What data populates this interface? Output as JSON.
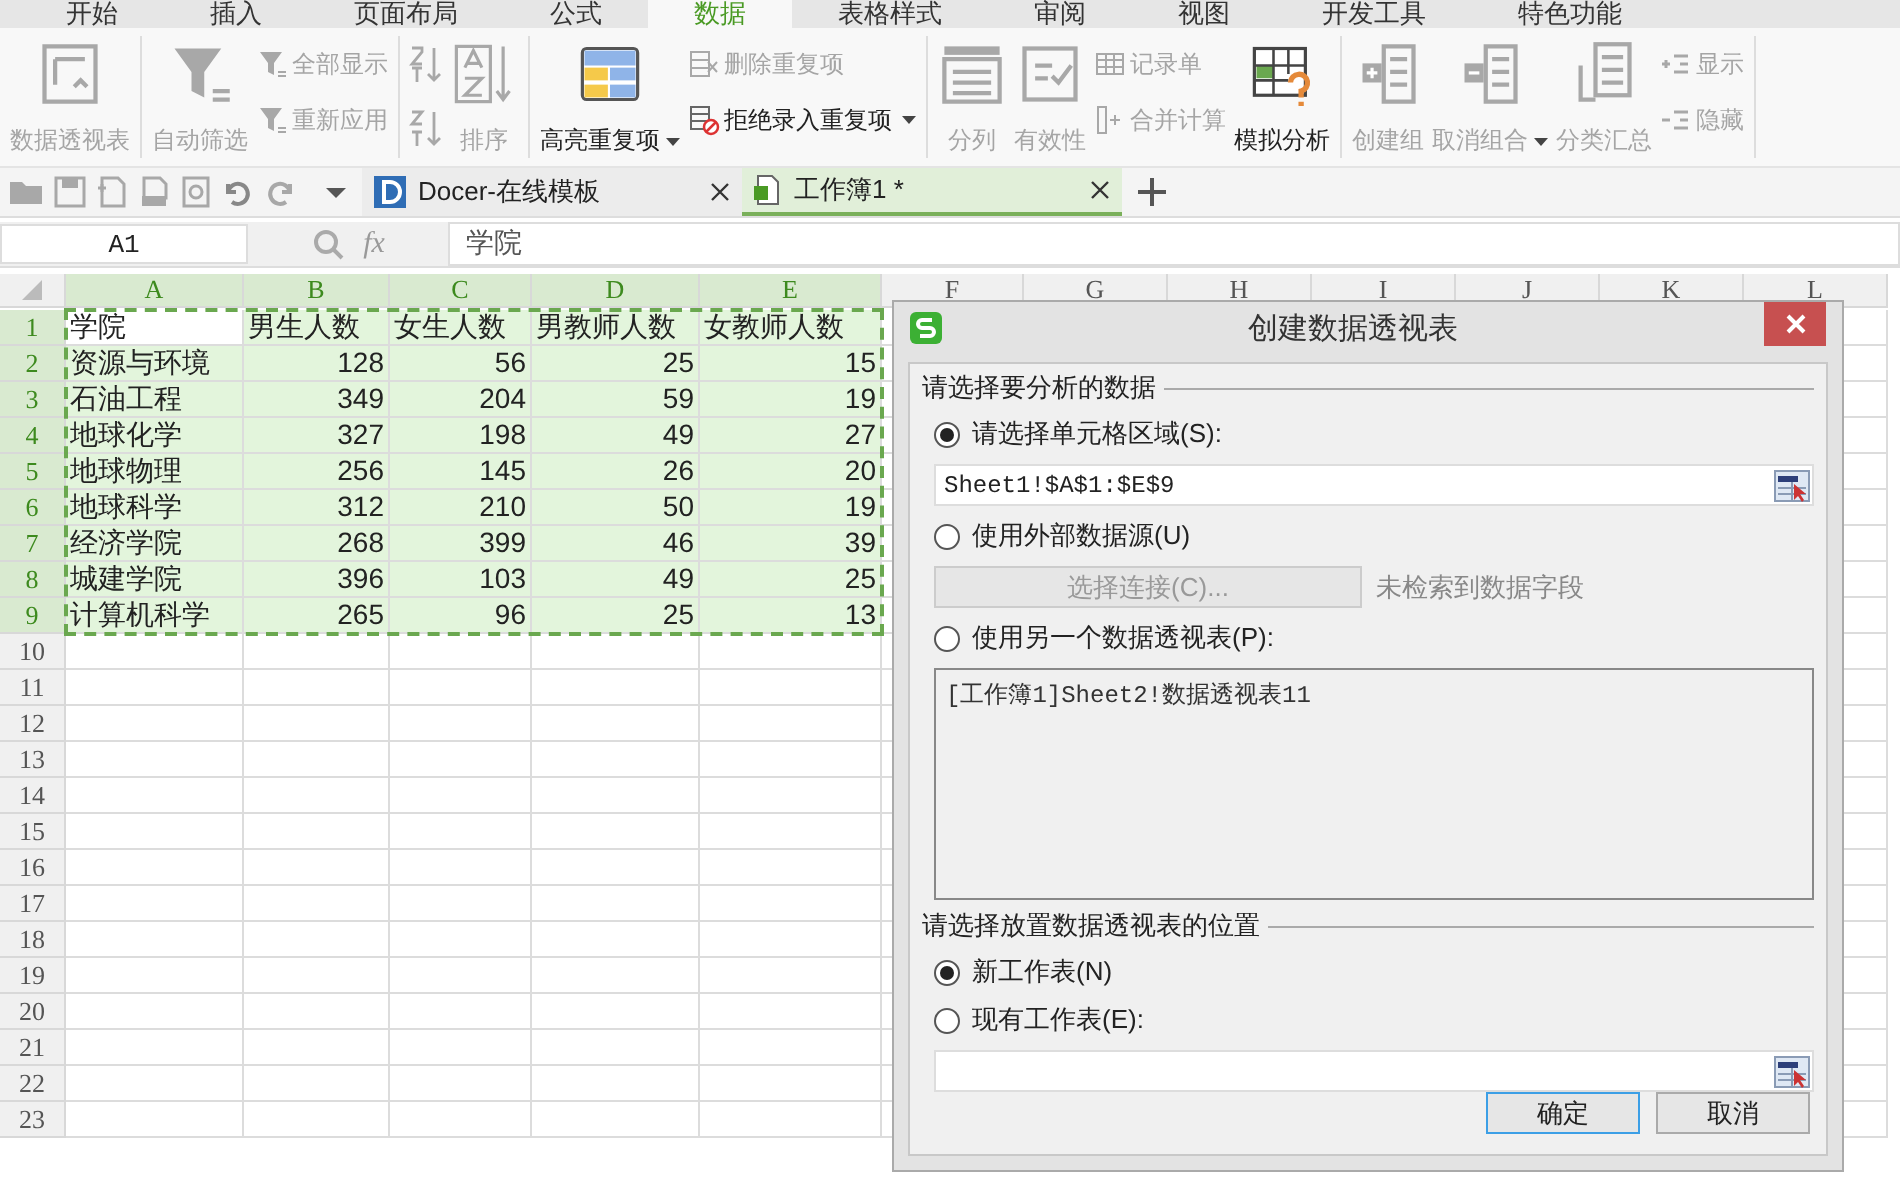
{
  "menu_tabs": [
    {
      "label": "开始",
      "selected": false
    },
    {
      "label": "插入",
      "selected": false
    },
    {
      "label": "页面布局",
      "selected": false
    },
    {
      "label": "公式",
      "selected": false
    },
    {
      "label": "数据",
      "selected": true
    },
    {
      "label": "表格样式",
      "selected": false
    },
    {
      "label": "审阅",
      "selected": false
    },
    {
      "label": "视图",
      "selected": false
    },
    {
      "label": "开发工具",
      "selected": false
    },
    {
      "label": "特色功能",
      "selected": false
    }
  ],
  "ribbon": {
    "groups": [
      {
        "items": [
          {
            "label": "数据透视表",
            "kind": "large",
            "disabled": true,
            "dropdown": false
          }
        ]
      },
      {
        "items": [
          {
            "label": "自动筛选",
            "kind": "large",
            "disabled": true,
            "dropdown": false
          },
          {
            "label": "全部显示",
            "kind": "small",
            "disabled": true,
            "dropdown": false
          },
          {
            "label": "重新应用",
            "kind": "small",
            "disabled": true,
            "dropdown": false
          }
        ]
      },
      {
        "items": [
          {
            "label": "排序",
            "kind": "sort",
            "disabled": true,
            "dropdown": false
          }
        ]
      },
      {
        "items": [
          {
            "label": "高亮重复项",
            "kind": "large",
            "disabled": false,
            "dropdown": true
          },
          {
            "label": "删除重复项",
            "kind": "small",
            "disabled": true,
            "dropdown": false
          },
          {
            "label": "拒绝录入重复项",
            "kind": "small",
            "disabled": false,
            "dropdown": true
          }
        ]
      },
      {
        "items": [
          {
            "label": "分列",
            "kind": "large",
            "disabled": true,
            "dropdown": false
          },
          {
            "label": "有效性",
            "kind": "large",
            "disabled": true,
            "dropdown": false
          },
          {
            "label": "记录单",
            "kind": "small",
            "disabled": true,
            "dropdown": false
          },
          {
            "label": "合并计算",
            "kind": "small",
            "disabled": true,
            "dropdown": false
          },
          {
            "label": "模拟分析",
            "kind": "large",
            "disabled": false,
            "dropdown": false
          }
        ]
      },
      {
        "items": [
          {
            "label": "创建组",
            "kind": "large",
            "disabled": true,
            "dropdown": false
          },
          {
            "label": "取消组合",
            "kind": "large",
            "disabled": true,
            "dropdown": true
          },
          {
            "label": "分类汇总",
            "kind": "large",
            "disabled": true,
            "dropdown": false
          },
          {
            "label": "显示",
            "kind": "small",
            "disabled": true,
            "dropdown": false
          },
          {
            "label": "隐藏",
            "kind": "small",
            "disabled": true,
            "dropdown": false
          }
        ]
      }
    ]
  },
  "doc_tabs": [
    {
      "label": "Docer-在线模板",
      "selected": false
    },
    {
      "label": "工作簿1 *",
      "selected": true
    }
  ],
  "formula_bar": {
    "name_box": "A1",
    "fx_label": "fx",
    "content": "学院"
  },
  "sheet": {
    "columns": [
      {
        "label": "A",
        "selected": true
      },
      {
        "label": "B",
        "selected": true
      },
      {
        "label": "C",
        "selected": true
      },
      {
        "label": "D",
        "selected": true
      },
      {
        "label": "E",
        "selected": true
      },
      {
        "label": "F",
        "selected": false
      },
      {
        "label": "G",
        "selected": false
      },
      {
        "label": "H",
        "selected": false
      },
      {
        "label": "I",
        "selected": false
      },
      {
        "label": "J",
        "selected": false
      },
      {
        "label": "K",
        "selected": false
      },
      {
        "label": "L",
        "selected": false
      }
    ],
    "rows": [
      {
        "label": "1",
        "selected": true,
        "active": true,
        "kind": "header",
        "cells": [
          "学院",
          "男生人数",
          "女生人数",
          "男教师人数",
          "女教师人数"
        ]
      },
      {
        "label": "2",
        "selected": true,
        "active": false,
        "kind": "data",
        "cells": [
          "资源与环境",
          "128",
          "56",
          "25",
          "15"
        ]
      },
      {
        "label": "3",
        "selected": true,
        "active": false,
        "kind": "data",
        "cells": [
          "石油工程",
          "349",
          "204",
          "59",
          "19"
        ]
      },
      {
        "label": "4",
        "selected": true,
        "active": false,
        "kind": "data",
        "cells": [
          "地球化学",
          "327",
          "198",
          "49",
          "27"
        ]
      },
      {
        "label": "5",
        "selected": true,
        "active": false,
        "kind": "data",
        "cells": [
          "地球物理",
          "256",
          "145",
          "26",
          "20"
        ]
      },
      {
        "label": "6",
        "selected": true,
        "active": false,
        "kind": "data",
        "cells": [
          "地球科学",
          "312",
          "210",
          "50",
          "19"
        ]
      },
      {
        "label": "7",
        "selected": true,
        "active": false,
        "kind": "data",
        "cells": [
          "经济学院",
          "268",
          "399",
          "46",
          "39"
        ]
      },
      {
        "label": "8",
        "selected": true,
        "active": false,
        "kind": "data",
        "cells": [
          "城建学院",
          "396",
          "103",
          "49",
          "25"
        ]
      },
      {
        "label": "9",
        "selected": true,
        "active": false,
        "kind": "data",
        "cells": [
          "计算机科学",
          "265",
          "96",
          "25",
          "13"
        ]
      },
      {
        "label": "10",
        "selected": false,
        "active": false,
        "kind": "data",
        "cells": []
      },
      {
        "label": "11",
        "selected": false,
        "active": false,
        "kind": "data",
        "cells": []
      },
      {
        "label": "12",
        "selected": false,
        "active": false,
        "kind": "data",
        "cells": []
      },
      {
        "label": "13",
        "selected": false,
        "active": false,
        "kind": "data",
        "cells": []
      },
      {
        "label": "14",
        "selected": false,
        "active": false,
        "kind": "data",
        "cells": []
      },
      {
        "label": "15",
        "selected": false,
        "active": false,
        "kind": "data",
        "cells": []
      },
      {
        "label": "16",
        "selected": false,
        "active": false,
        "kind": "data",
        "cells": []
      },
      {
        "label": "17",
        "selected": false,
        "active": false,
        "kind": "data",
        "cells": []
      },
      {
        "label": "18",
        "selected": false,
        "active": false,
        "kind": "data",
        "cells": []
      },
      {
        "label": "19",
        "selected": false,
        "active": false,
        "kind": "data",
        "cells": []
      },
      {
        "label": "20",
        "selected": false,
        "active": false,
        "kind": "data",
        "cells": []
      },
      {
        "label": "21",
        "selected": false,
        "active": false,
        "kind": "data",
        "cells": []
      },
      {
        "label": "22",
        "selected": false,
        "active": false,
        "kind": "data",
        "cells": []
      },
      {
        "label": "23",
        "selected": false,
        "active": false,
        "kind": "data",
        "cells": []
      }
    ]
  },
  "dialog": {
    "title": "创建数据透视表",
    "sections": [
      {
        "title": "请选择要分析的数据",
        "items": [
          {
            "kind": "radio",
            "label": "请选择单元格区域(S):",
            "selected": true
          },
          {
            "kind": "range-field",
            "value": "Sheet1!$A$1:$E$9"
          },
          {
            "kind": "radio",
            "label": "使用外部数据源(U)",
            "selected": false
          },
          {
            "kind": "connect",
            "button": "选择连接(C)...",
            "note": "未检索到数据字段",
            "disabled": true
          },
          {
            "kind": "radio",
            "label": "使用另一个数据透视表(P):",
            "selected": false
          },
          {
            "kind": "listbox",
            "value": "[工作簿1]Sheet2!数据透视表11"
          }
        ]
      },
      {
        "title": "请选择放置数据透视表的位置",
        "items": [
          {
            "kind": "radio",
            "label": "新工作表(N)",
            "selected": true
          },
          {
            "kind": "radio",
            "label": "现有工作表(E):",
            "selected": false
          },
          {
            "kind": "range-field"
          }
        ]
      }
    ],
    "buttons": [
      {
        "label": "确定",
        "default": true
      },
      {
        "label": "取消",
        "default": false
      }
    ]
  }
}
